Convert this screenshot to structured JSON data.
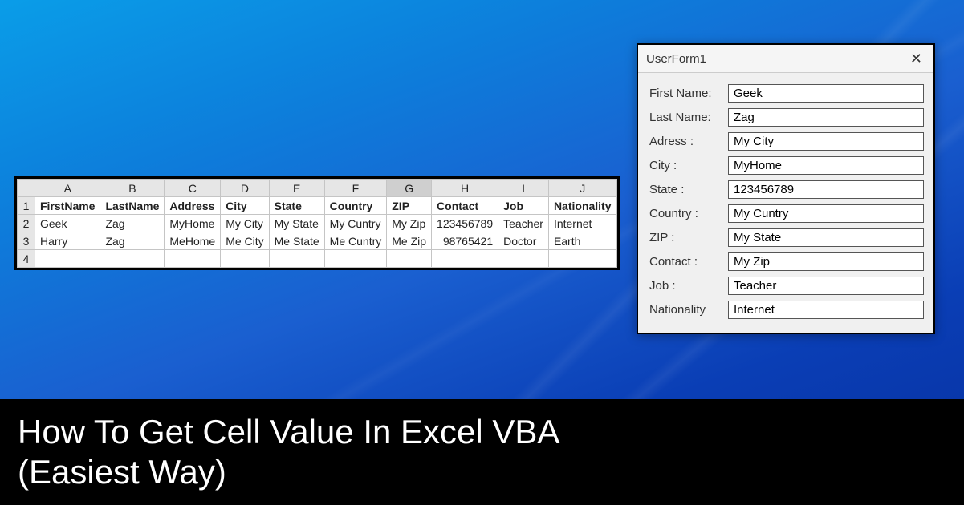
{
  "excel": {
    "columns": [
      "A",
      "B",
      "C",
      "D",
      "E",
      "F",
      "G",
      "H",
      "I",
      "J"
    ],
    "selected_col": "G",
    "row_nums": [
      "1",
      "2",
      "3",
      "4"
    ],
    "headers": [
      "FirstName",
      "LastName",
      "Address",
      "City",
      "State",
      "Country",
      "ZIP",
      "Contact",
      "Job",
      "Nationality"
    ],
    "rows": [
      {
        "a": "Geek",
        "b": "Zag",
        "c": "MyHome",
        "d": "My City",
        "e": "My State",
        "f": "My Cuntry",
        "g": "My Zip",
        "h": "123456789",
        "i": "Teacher",
        "j": "Internet"
      },
      {
        "a": "Harry",
        "b": "Zag",
        "c": "MeHome",
        "d": "Me City",
        "e": "Me State",
        "f": "Me Cuntry",
        "g": "Me Zip",
        "h": "98765421",
        "i": "Doctor",
        "j": "Earth"
      }
    ]
  },
  "userform": {
    "title": "UserForm1",
    "fields": [
      {
        "label": "First Name:",
        "value": "Geek"
      },
      {
        "label": "Last Name:",
        "value": "Zag"
      },
      {
        "label": "Adress    :",
        "value": "My City"
      },
      {
        "label": "City         :",
        "value": "MyHome"
      },
      {
        "label": "State       :",
        "value": "123456789"
      },
      {
        "label": "Country   :",
        "value": "My Cuntry"
      },
      {
        "label": "ZIP          :",
        "value": "My State"
      },
      {
        "label": "Contact  :",
        "value": "My Zip"
      },
      {
        "label": "Job          :",
        "value": "Teacher"
      },
      {
        "label": "Nationality",
        "value": "Internet"
      }
    ]
  },
  "footer": {
    "line1": "How To Get Cell Value In Excel VBA",
    "line2": "(Easiest Way)"
  }
}
